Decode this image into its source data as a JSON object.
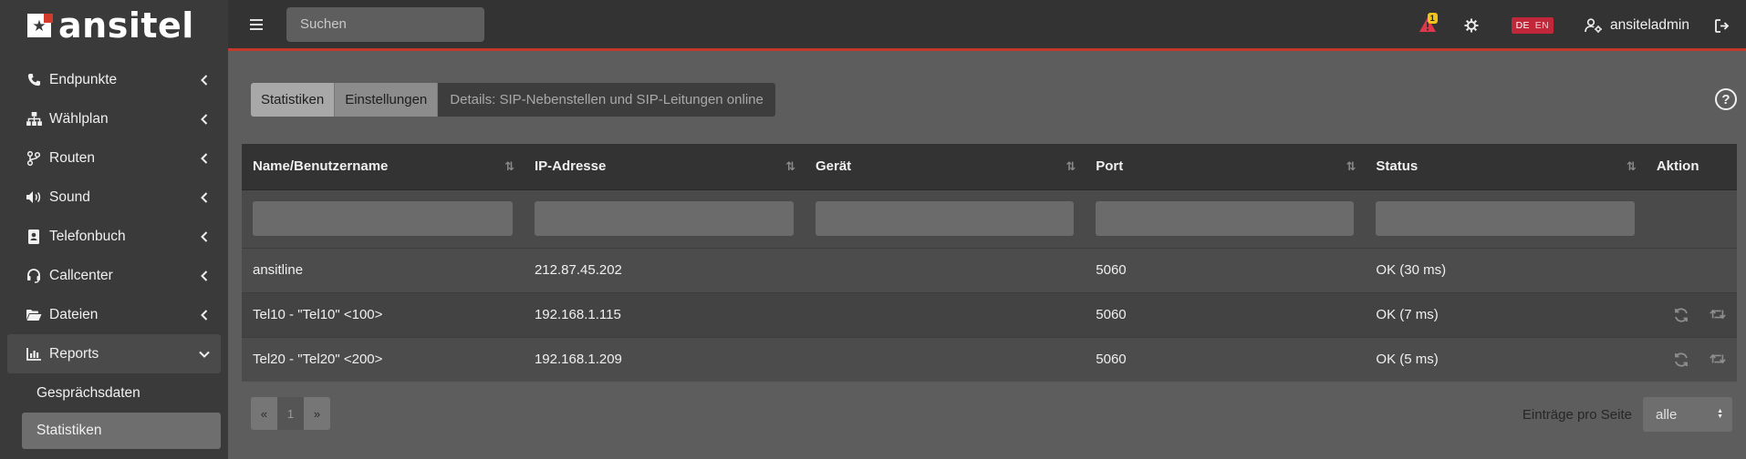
{
  "brand": {
    "name": "ansitel"
  },
  "search": {
    "placeholder": "Suchen"
  },
  "sidebar": {
    "items": [
      {
        "label": "Endpunkte",
        "icon": "phone-icon"
      },
      {
        "label": "Wählplan",
        "icon": "sitemap-icon"
      },
      {
        "label": "Routen",
        "icon": "route-icon"
      },
      {
        "label": "Sound",
        "icon": "volume-icon"
      },
      {
        "label": "Telefonbuch",
        "icon": "address-book-icon"
      },
      {
        "label": "Callcenter",
        "icon": "headset-icon"
      },
      {
        "label": "Dateien",
        "icon": "folder-open-icon"
      },
      {
        "label": "Reports",
        "icon": "chart-bar-icon"
      }
    ],
    "subitems": [
      {
        "label": "Gesprächsdaten"
      },
      {
        "label": "Statistiken"
      }
    ]
  },
  "topbar": {
    "alert_count": "1",
    "lang_de": "DE",
    "lang_en": "EN",
    "username": "ansiteladmin"
  },
  "tabs": {
    "statistiken": "Statistiken",
    "einstellungen": "Einstellungen",
    "details": "Details: SIP-Nebenstellen und SIP-Leitungen online"
  },
  "table": {
    "columns": [
      "Name/Benutzername",
      "IP-Adresse",
      "Gerät",
      "Port",
      "Status",
      "Aktion"
    ],
    "rows": [
      {
        "name": "ansitline",
        "ip": "212.87.45.202",
        "device": "",
        "port": "5060",
        "status": "OK (30 ms)"
      },
      {
        "name": "Tel10 - \"Tel10\" <100>",
        "ip": "192.168.1.115",
        "device": "",
        "port": "5060",
        "status": "OK (7 ms)"
      },
      {
        "name": "Tel20 - \"Tel20\" <200>",
        "ip": "192.168.1.209",
        "device": "",
        "port": "5060",
        "status": "OK (5 ms)"
      }
    ]
  },
  "pagination": {
    "prev": "«",
    "current": "1",
    "next": "»"
  },
  "per_page": {
    "label": "Einträge pro Seite",
    "value": "alle"
  },
  "colors": {
    "accent": "#c0392b",
    "sidebar": "#3a3a3a",
    "topbar": "#333333"
  }
}
